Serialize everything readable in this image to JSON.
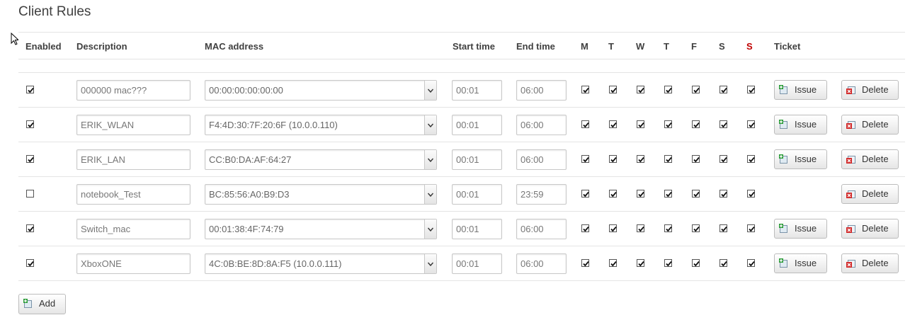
{
  "page": {
    "title": "Client Rules"
  },
  "headers": {
    "enabled": "Enabled",
    "description": "Description",
    "mac": "MAC address",
    "start": "Start time",
    "end": "End time",
    "days": [
      "M",
      "T",
      "W",
      "T",
      "F",
      "S",
      "S"
    ],
    "ticket": "Ticket"
  },
  "colors": {
    "sunday": "#c00000"
  },
  "buttons": {
    "issue": "Issue",
    "delete": "Delete",
    "add": "Add"
  },
  "rows": [
    {
      "enabled": true,
      "description": "000000 mac???",
      "mac": "00:00:00:00:00:00",
      "start": "00:01",
      "end": "06:00",
      "days": [
        true,
        true,
        true,
        true,
        true,
        true,
        true
      ],
      "ticket": true
    },
    {
      "enabled": true,
      "description": "ERIK_WLAN",
      "mac": "F4:4D:30:7F:20:6F (10.0.0.110)",
      "start": "00:01",
      "end": "06:00",
      "days": [
        true,
        true,
        true,
        true,
        true,
        true,
        true
      ],
      "ticket": true
    },
    {
      "enabled": true,
      "description": "ERIK_LAN",
      "mac": "CC:B0:DA:AF:64:27",
      "start": "00:01",
      "end": "06:00",
      "days": [
        true,
        true,
        true,
        true,
        true,
        true,
        true
      ],
      "ticket": true
    },
    {
      "enabled": false,
      "description": "notebook_Test",
      "mac": "BC:85:56:A0:B9:D3",
      "start": "00:01",
      "end": "23:59",
      "days": [
        true,
        true,
        true,
        true,
        true,
        true,
        true
      ],
      "ticket": false
    },
    {
      "enabled": true,
      "description": "Switch_mac",
      "mac": "00:01:38:4F:74:79",
      "start": "00:01",
      "end": "06:00",
      "days": [
        true,
        true,
        true,
        true,
        true,
        true,
        true
      ],
      "ticket": true
    },
    {
      "enabled": true,
      "description": "XboxONE",
      "mac": "4C:0B:BE:8D:8A:F5 (10.0.0.111)",
      "start": "00:01",
      "end": "06:00",
      "days": [
        true,
        true,
        true,
        true,
        true,
        true,
        true
      ],
      "ticket": true
    }
  ]
}
